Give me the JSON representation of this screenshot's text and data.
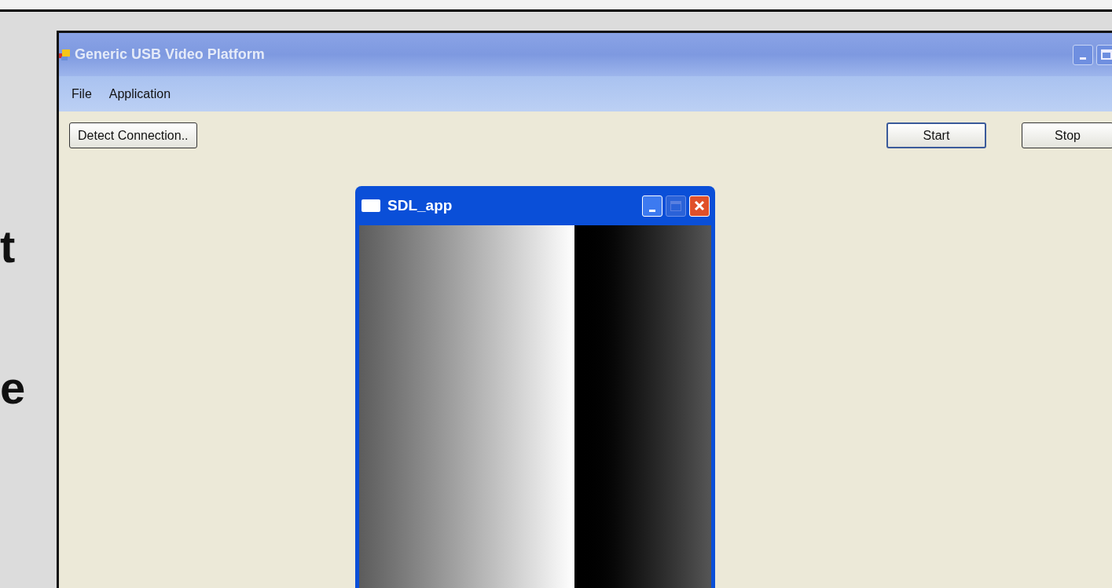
{
  "slide_text": [
    "t",
    "e"
  ],
  "window": {
    "title": "Generic USB Video Platform",
    "menu": [
      "File",
      "Application"
    ],
    "buttons": {
      "detect": "Detect Connection..",
      "start": "Start",
      "stop": "Stop"
    }
  },
  "sdl_window": {
    "title": "SDL_app"
  }
}
